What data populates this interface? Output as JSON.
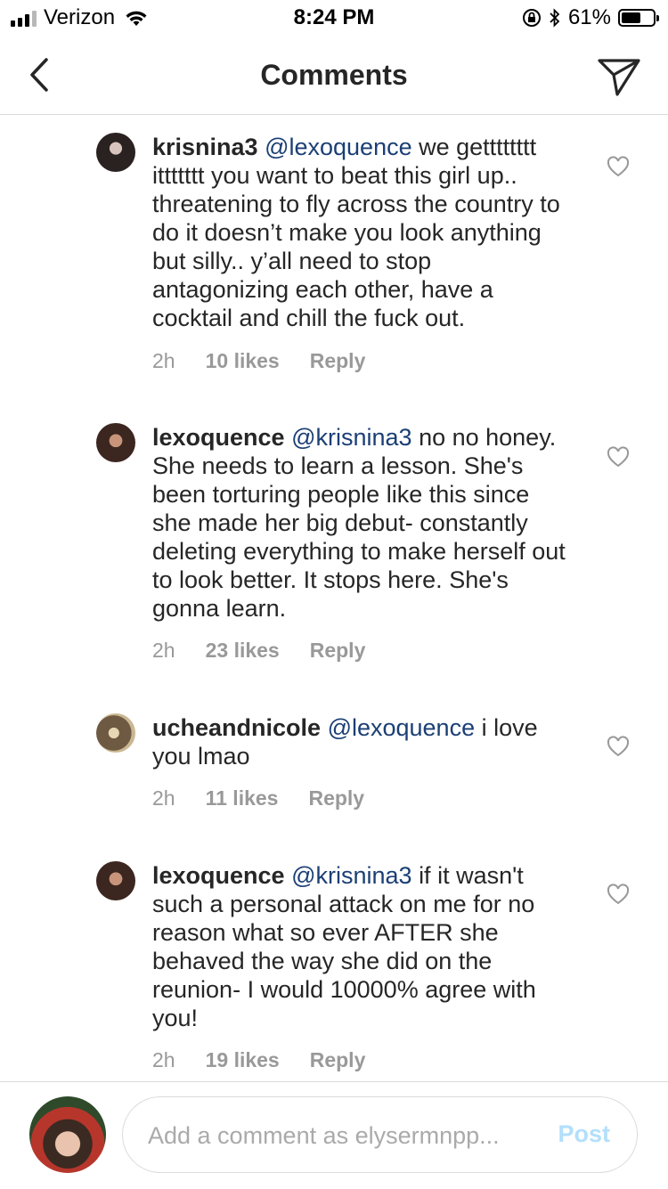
{
  "status": {
    "carrier": "Verizon",
    "time": "8:24 PM",
    "battery": "61%",
    "battery_level": 0.61
  },
  "nav": {
    "title": "Comments",
    "back_icon": "chevron-left-icon",
    "send_icon": "paper-plane-icon"
  },
  "comments": [
    {
      "username": "krisnina3",
      "mention": "@lexoquence",
      "text": "we getttttttt ittttttt you want to beat this girl up.. threatening to fly across the country to do it doesn’t make you look anything but silly.. y’all need to stop antagonizing each other, have a cocktail and chill the fuck out.",
      "time": "2h",
      "likes": "10 likes",
      "reply": "Reply"
    },
    {
      "username": "lexoquence",
      "mention": "@krisnina3",
      "text": "no no honey. She needs to learn a lesson. She's been torturing people like this since she made her big debut- constantly deleting everything to make herself out to look better. It stops here. She's gonna learn.",
      "time": "2h",
      "likes": "23 likes",
      "reply": "Reply"
    },
    {
      "username": "ucheandnicole",
      "mention": "@lexoquence",
      "text": "i love you lmao",
      "time": "2h",
      "likes": "11 likes",
      "reply": "Reply"
    },
    {
      "username": "lexoquence",
      "mention": "@krisnina3",
      "text": "if it wasn't such a personal attack on me for no reason what so ever AFTER she behaved the way she did on the reunion- I would 10000% agree with you!",
      "time": "2h",
      "likes": "19 likes",
      "reply": "Reply"
    }
  ],
  "composer": {
    "placeholder": "Add a comment as elysermnpp...",
    "post_label": "Post"
  }
}
